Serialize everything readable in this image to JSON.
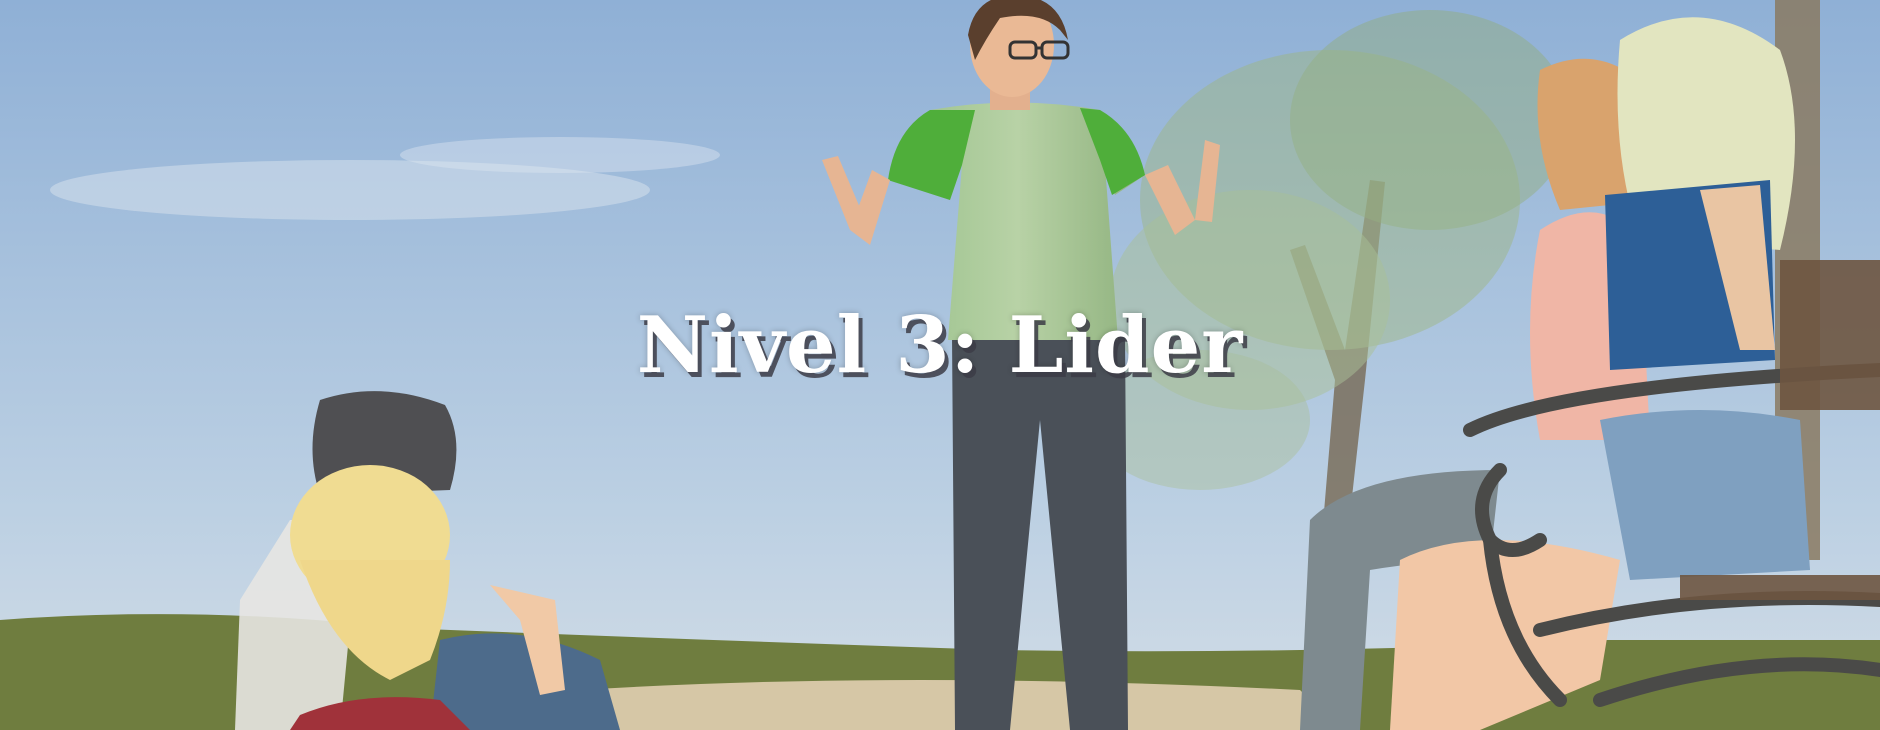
{
  "title": "Nivel 3: Lider",
  "colors": {
    "sky_top": "#8fb0d6",
    "sky_bottom": "#c9d6e2",
    "grass": "#6f7d3f",
    "sand": "#d6c7a6",
    "shirt_green": "#4fae3a",
    "shirt_body": "#a9c79a",
    "jeans": "#4a5058"
  }
}
